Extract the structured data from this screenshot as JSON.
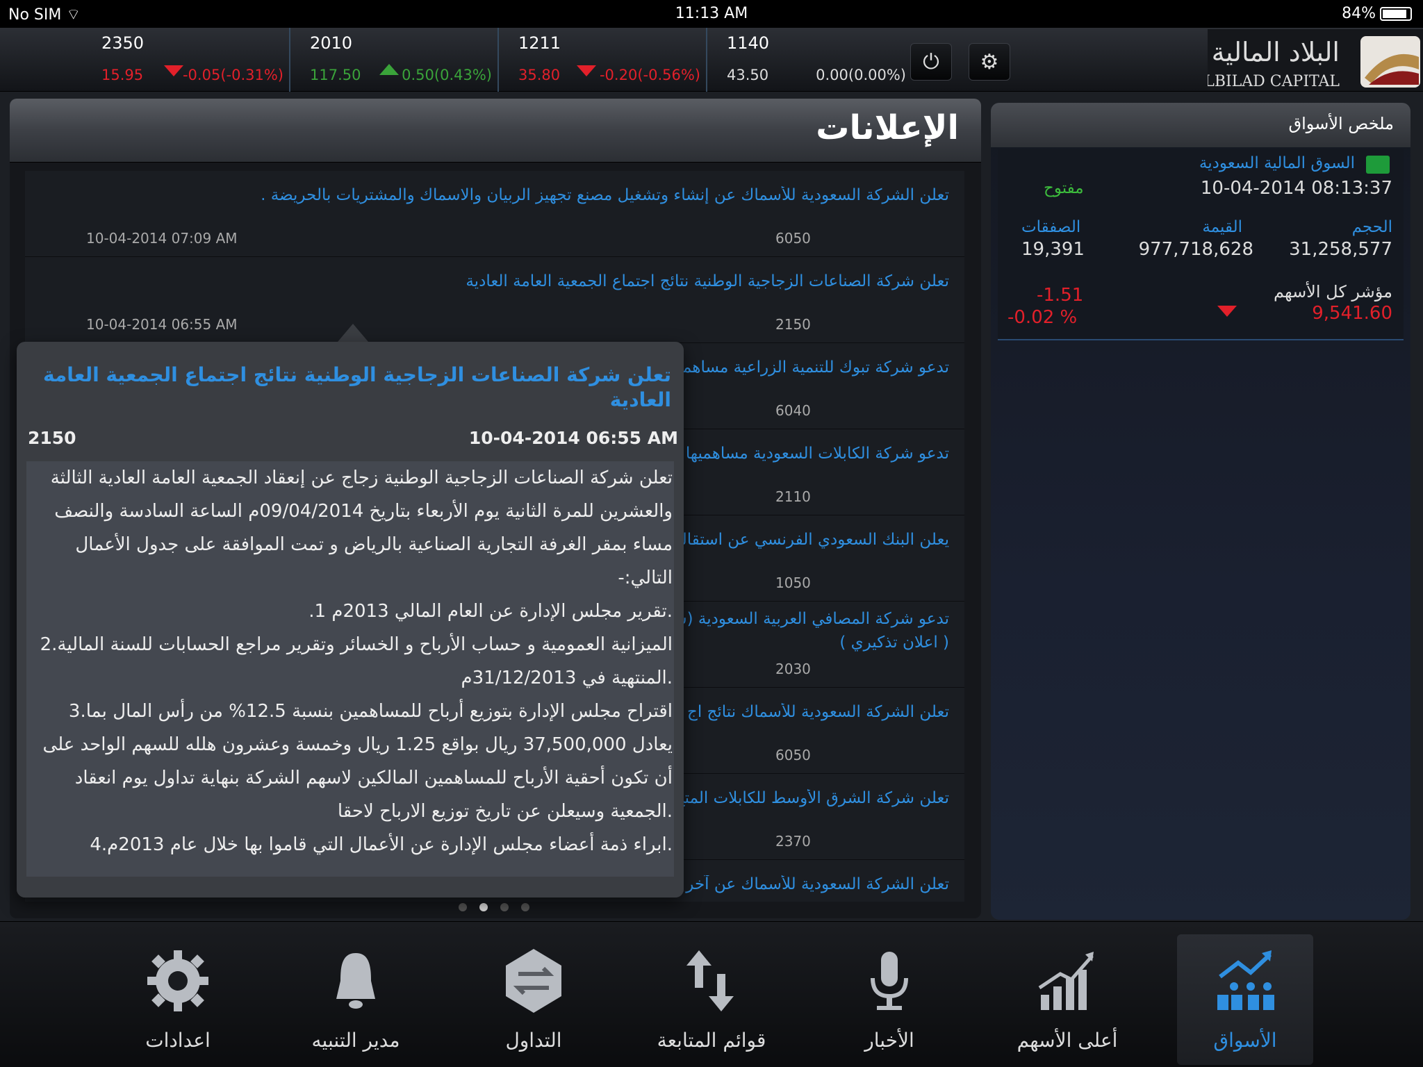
{
  "status": {
    "carrier": "No SIM",
    "time": "11:13 AM",
    "battery": "84%"
  },
  "ticker": [
    {
      "symbol": "2350",
      "price": "15.95",
      "change": "-0.05(-0.31%)",
      "direction": "down"
    },
    {
      "symbol": "2010",
      "price": "117.50",
      "change": "0.50(0.43%)",
      "direction": "up"
    },
    {
      "symbol": "1211",
      "price": "35.80",
      "change": "-0.20(-0.56%)",
      "direction": "down"
    },
    {
      "symbol": "1140",
      "price": "43.50",
      "change": "0.00(0.00%)",
      "direction": "none"
    }
  ],
  "logo": {
    "arabic": "البلاد المالية",
    "english": "ALBILAD CAPITAL"
  },
  "main": {
    "title": "الإعلانات",
    "announcements": [
      {
        "text": "تعلن الشركة السعودية للأسماك عن إنشاء وتشغيل مصنع تجهيز الربيان والاسماك والمشتريات بالحريضة .",
        "code": "6050",
        "date": "10-04-2014 07:09 AM"
      },
      {
        "text": "تعلن شركة الصناعات الزجاجية الوطنية نتائج اجتماع الجمعية العامة العادية",
        "code": "2150",
        "date": "10-04-2014 06:55 AM"
      },
      {
        "text": "تدعو شركة تبوك للتنمية الزراعية مساهمي",
        "code": "6040",
        "date": ""
      },
      {
        "text": "تدعو شركة الكابلات السعودية مساهميها",
        "code": "2110",
        "date": ""
      },
      {
        "text": "يعلن البنك السعودي الفرنسي عن استقالة",
        "code": "1050",
        "date": ""
      },
      {
        "text": "تدعو شركة المصافي العربية السعودية (س",
        "text2": "( اعلان تذكيري )",
        "code": "2030",
        "date": ""
      },
      {
        "text": "تعلن الشركة السعودية للأسماك نتائج اج",
        "code": "6050",
        "date": ""
      },
      {
        "text": "تعلن شركة الشرق الأوسط للكابلات المتخ",
        "code": "2370",
        "date": ""
      },
      {
        "text": "تعلن الشركة السعودية للأسماك عن آخر",
        "code": "",
        "date": ""
      }
    ]
  },
  "popover": {
    "title": "تعلن شركة الصناعات الزجاجية الوطنية نتائج اجتماع الجمعية العامة العادية",
    "code": "2150",
    "date": "10-04-2014 06:55 AM",
    "body": [
      "تعلن شركة الصناعات الزجاجية الوطنية زجاج عن إنعقاد الجمعية العامة العادية الثالثة",
      "والعشرين للمرة الثانية يوم الأربعاء بتاريخ 09/04/2014م الساعة السادسة والنصف",
      "مساء بمقر الغرفة التجارية الصناعية بالرياض و تمت الموافقة على جدول الأعمال",
      "التالي:-",
      ".تقرير مجلس الإدارة عن العام المالي 2013م 1.",
      "الميزانية العمومية و حساب الأرباح و الخسائر وتقرير مراجع الحسابات للسنة المالية.2",
      ".المنتهية في 31/12/2013م",
      "اقتراح مجلس الإدارة بتوزيع أرباح للمساهمين بنسبة 12.5% من رأس المال بما.3",
      "يعادل 37,500,000 ريال بواقع 1.25 ريال وخمسة وعشرون هلله للسهم الواحد على",
      "أن تكون أحقية الأرباح للمساهمين المالكين لاسهم الشركة بنهاية تداول يوم انعقاد",
      ".الجمعية وسيعلن عن تاريخ توزيع الارباح لاحقا",
      ".ابراء ذمة أعضاء مجلس الإدارة عن الأعمال التي قاموا بها خلال عام 2013م.4"
    ]
  },
  "side": {
    "title": "ملخص الأسواق",
    "market_name": "السوق المالية السعودية",
    "datetime": "10-04-2014 08:13:37",
    "status": "مفتوح",
    "volume_label": "الحجم",
    "volume": "31,258,577",
    "value_label": "القيمة",
    "value": "977,718,628",
    "trades_label": "الصفقات",
    "trades": "19,391",
    "index_label": "مؤشر كل الأسهم",
    "index_value": "9,541.60",
    "index_change": "-1.51",
    "index_change_pct": "-0.02 %"
  },
  "tabs": [
    {
      "label": "اعدادات",
      "icon": "gear-icon"
    },
    {
      "label": "مدير التنبيه",
      "icon": "bell-icon"
    },
    {
      "label": "التداول",
      "icon": "trade-arrows-icon"
    },
    {
      "label": "قوائم المتابعة",
      "icon": "updown-arrows-icon"
    },
    {
      "label": "الأخبار",
      "icon": "microphone-icon"
    },
    {
      "label": "أعلى الأسهم",
      "icon": "bar-chart-up-icon"
    },
    {
      "label": "الأسواق",
      "icon": "markets-icon"
    }
  ],
  "colors": {
    "accent": "#2f8fe0",
    "up": "#3aa33a",
    "down": "#e2202a",
    "open": "#3dbd3d"
  }
}
